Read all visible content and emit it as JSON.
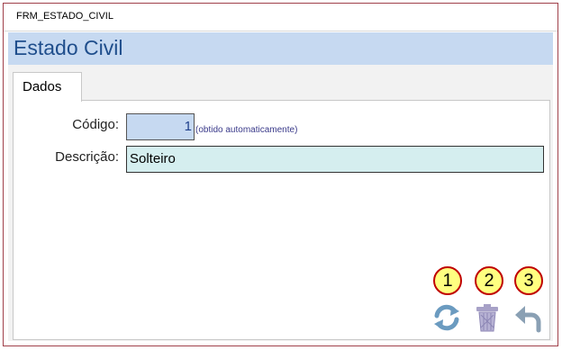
{
  "window": {
    "title": "FRM_ESTADO_CIVIL"
  },
  "header": {
    "title": "Estado Civil"
  },
  "tabs": [
    {
      "label": "Dados"
    }
  ],
  "form": {
    "codigo": {
      "label": "Código:",
      "value": "1",
      "hint": "(obtido automaticamente)"
    },
    "descricao": {
      "label": "Descrição:",
      "value": "Solteiro"
    }
  },
  "buttons": [
    {
      "icon": "refresh-icon",
      "badge": "1"
    },
    {
      "icon": "trash-icon",
      "badge": "2"
    },
    {
      "icon": "undo-arrow-icon",
      "badge": "3"
    }
  ],
  "colors": {
    "header_bg": "#c6d9f1",
    "header_text": "#1f4e8c",
    "codigo_bg": "#c6d9f1",
    "descricao_bg": "#d5eeef",
    "badge_fill": "#ffff80",
    "badge_border": "#c00000",
    "window_border": "#a0404a"
  }
}
